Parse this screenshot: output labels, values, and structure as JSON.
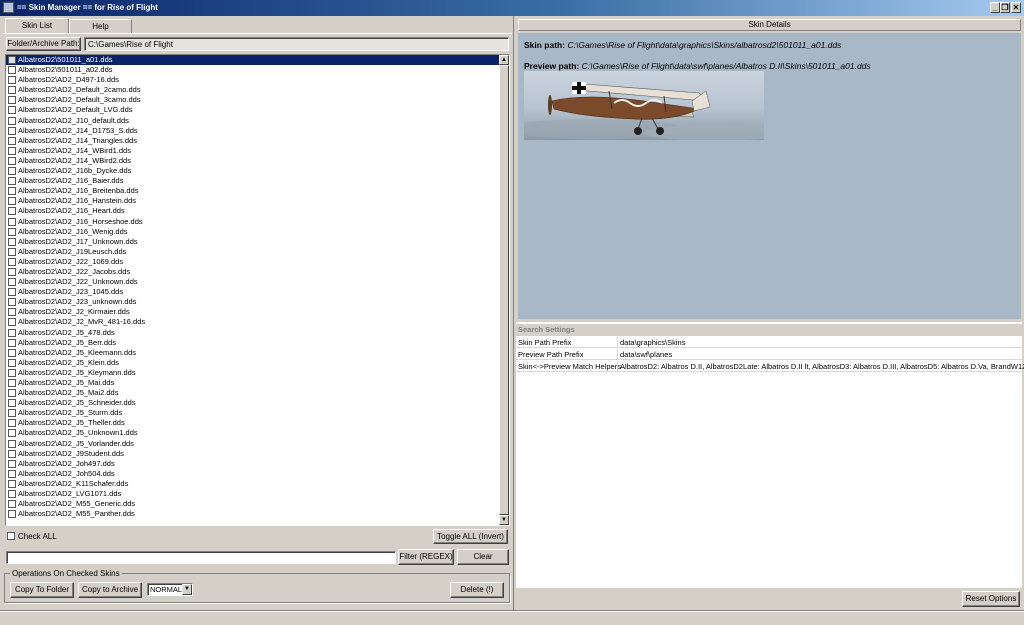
{
  "window": {
    "title": "== Skin Manager == for Rise of Flight",
    "minimize": "_",
    "restore": "❐",
    "close": "✕"
  },
  "tabs": {
    "skin_list": "Skin List",
    "help": "Help"
  },
  "path_bar": {
    "button_label": "Folder/Archive Path:",
    "value": "C:\\Games\\Rise of Flight"
  },
  "skins": [
    "AlbatrosD2\\501011_a01.dds",
    "AlbatrosD2\\501011_a02.dds",
    "AlbatrosD2\\AD2_D497-16.dds",
    "AlbatrosD2\\AD2_Default_2camo.dds",
    "AlbatrosD2\\AD2_Default_3camo.dds",
    "AlbatrosD2\\AD2_Default_LVG.dds",
    "AlbatrosD2\\AD2_J10_default.dds",
    "AlbatrosD2\\AD2_J14_D1753_S.dds",
    "AlbatrosD2\\AD2_J14_Triangles.dds",
    "AlbatrosD2\\AD2_J14_WBird1.dds",
    "AlbatrosD2\\AD2_J14_WBird2.dds",
    "AlbatrosD2\\AD2_J16b_Dycke.dds",
    "AlbatrosD2\\AD2_J16_Baier.dds",
    "AlbatrosD2\\AD2_J16_Breitenba.dds",
    "AlbatrosD2\\AD2_J16_Hanstein.dds",
    "AlbatrosD2\\AD2_J16_Heart.dds",
    "AlbatrosD2\\AD2_J16_Horseshoe.dds",
    "AlbatrosD2\\AD2_J16_Wenig.dds",
    "AlbatrosD2\\AD2_J17_Unknown.dds",
    "AlbatrosD2\\AD2_J19Leusch.dds",
    "AlbatrosD2\\AD2_J22_1069.dds",
    "AlbatrosD2\\AD2_J22_Jacobs.dds",
    "AlbatrosD2\\AD2_J22_Unknown.dds",
    "AlbatrosD2\\AD2_J23_1045.dds",
    "AlbatrosD2\\AD2_J23_unknown.dds",
    "AlbatrosD2\\AD2_J2_Kirmaier.dds",
    "AlbatrosD2\\AD2_J2_MvR_481-16.dds",
    "AlbatrosD2\\AD2_J5_478.dds",
    "AlbatrosD2\\AD2_J5_Berr.dds",
    "AlbatrosD2\\AD2_J5_Kleemann.dds",
    "AlbatrosD2\\AD2_J5_Klein.dds",
    "AlbatrosD2\\AD2_J5_Kleymann.dds",
    "AlbatrosD2\\AD2_J5_Mai.dds",
    "AlbatrosD2\\AD2_J5_Mai2.dds",
    "AlbatrosD2\\AD2_J5_Schneider.dds",
    "AlbatrosD2\\AD2_J5_Sturm.dds",
    "AlbatrosD2\\AD2_J5_Theller.dds",
    "AlbatrosD2\\AD2_J5_Unknown1.dds",
    "AlbatrosD2\\AD2_J5_Vorlander.dds",
    "AlbatrosD2\\AD2_J9Student.dds",
    "AlbatrosD2\\AD2_Joh497.dds",
    "AlbatrosD2\\AD2_Joh504.dds",
    "AlbatrosD2\\AD2_K11Schafer.dds",
    "AlbatrosD2\\AD2_LVG1071.dds",
    "AlbatrosD2\\AD2_M55_Generic.dds",
    "AlbatrosD2\\AD2_M55_Panther.dds"
  ],
  "controls": {
    "check_all": "Check ALL",
    "toggle_all": "Toggle ALL (Invert)",
    "filter_value": "",
    "filter_button": "Filter (REGEX)",
    "clear_button": "Clear"
  },
  "operations": {
    "group_label": "Operations On Checked Skins",
    "copy_to_folder": "Copy To Folder",
    "copy_to_archive": "Copy to Archive",
    "mode_selected": "NORMAL",
    "delete": "Delete (!)"
  },
  "details": {
    "header": "Skin Details",
    "skin_path_label": "Skin path:",
    "skin_path_value": "C:\\Games\\Rise of Flight\\data\\graphics\\Skins/albatrosd2\\501011_a01.dds",
    "preview_path_label": "Preview path:",
    "preview_path_value": "C:\\Games\\Rise of Flight\\data\\swf\\planes/Albatros D.II\\Skins\\501011_a01.dds"
  },
  "search_settings": {
    "header": "Search Settings",
    "rows": [
      {
        "key": "Skin Path Prefix",
        "value": "data\\graphics\\Skins"
      },
      {
        "key": "Preview Path Prefix",
        "value": "data\\swf\\planes"
      },
      {
        "key": "Skin<->Preview Match Helpers",
        "value": "AlbatrosD2: Albatros D.II, AlbatrosD2Late: Albatros D.II lt, AlbatrosD3: Albatros D.III, AlbatrosD5: Albatros D.Va, BrandW12"
      }
    ],
    "reset_button": "Reset Options"
  },
  "colors": {
    "selection": "#0a246a",
    "preview_bg": "#a9b8c6",
    "window_face": "#d4d0c8"
  }
}
